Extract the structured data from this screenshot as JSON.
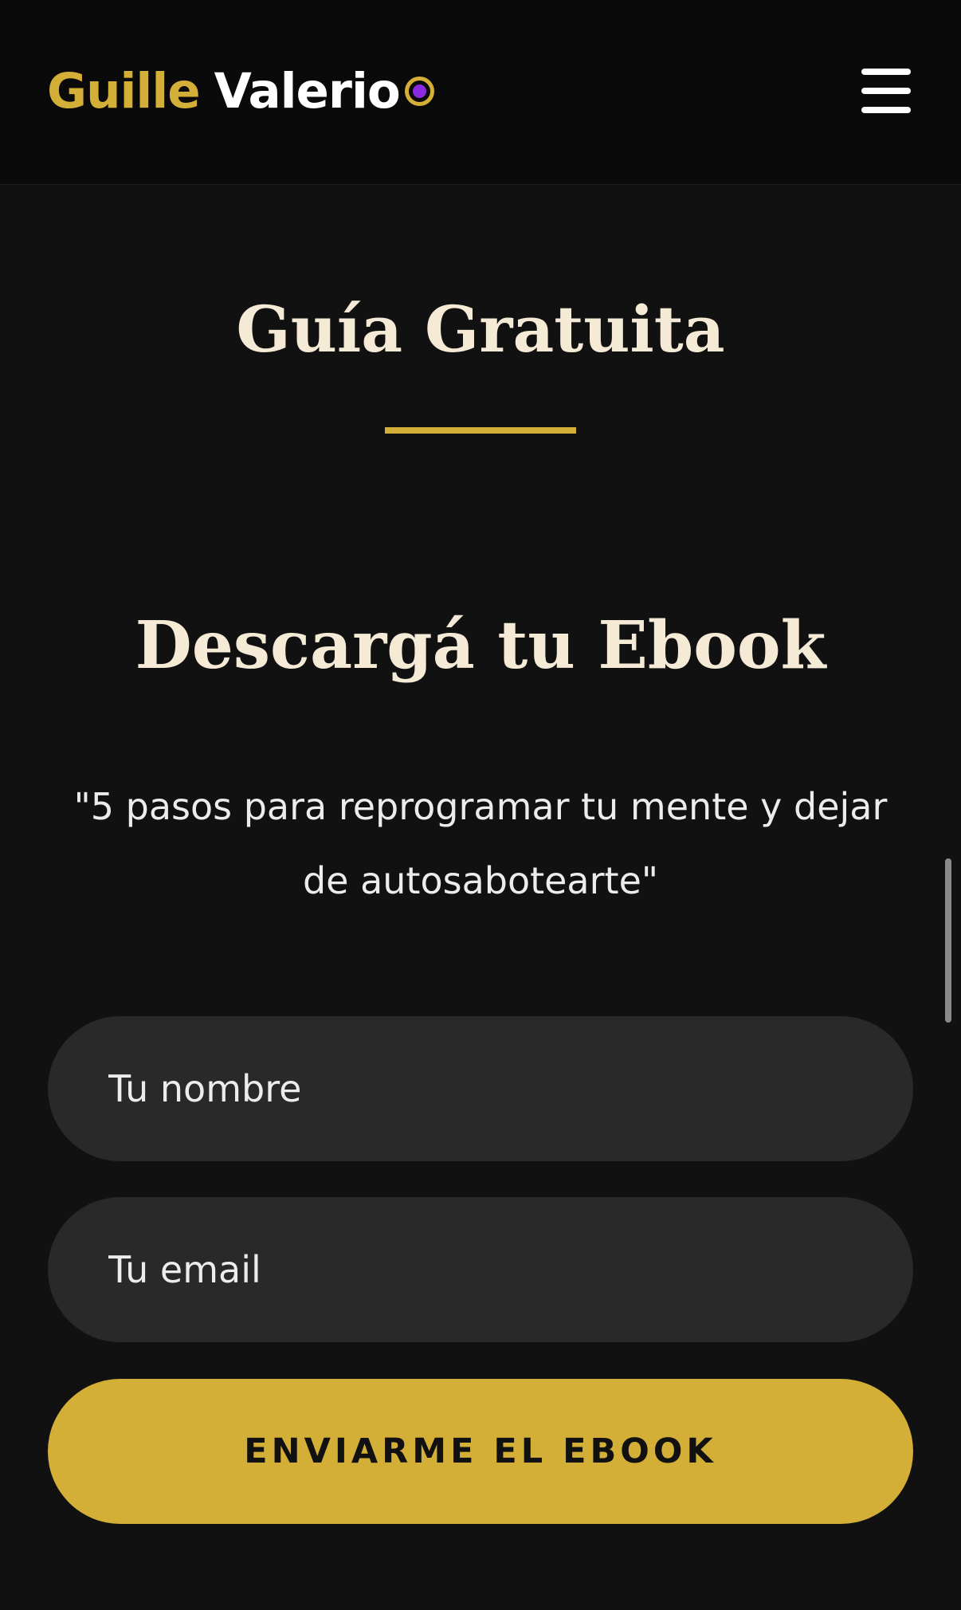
{
  "header": {
    "logo": {
      "first_name": "Guille",
      "last_name": "Valerio",
      "dot_icon": "circle-dot-icon"
    },
    "menu_icon": "hamburger-menu-icon"
  },
  "section": {
    "label": "Guía Gratuita",
    "title": "Descargá tu Ebook",
    "subtitle": "\"5 pasos para reprogramar tu mente y dejar de autosabotearte\""
  },
  "form": {
    "name_placeholder": "Tu nombre",
    "name_value": "",
    "email_placeholder": "Tu email",
    "email_value": "",
    "submit_label": "ENVIARME EL EBOOK"
  },
  "colors": {
    "accent": "#d4af37",
    "background": "#111111",
    "header_background": "#0a0a0a",
    "heading_text": "#f5ead6",
    "field_background": "#292929",
    "logo_dot": "#8a2be2"
  }
}
